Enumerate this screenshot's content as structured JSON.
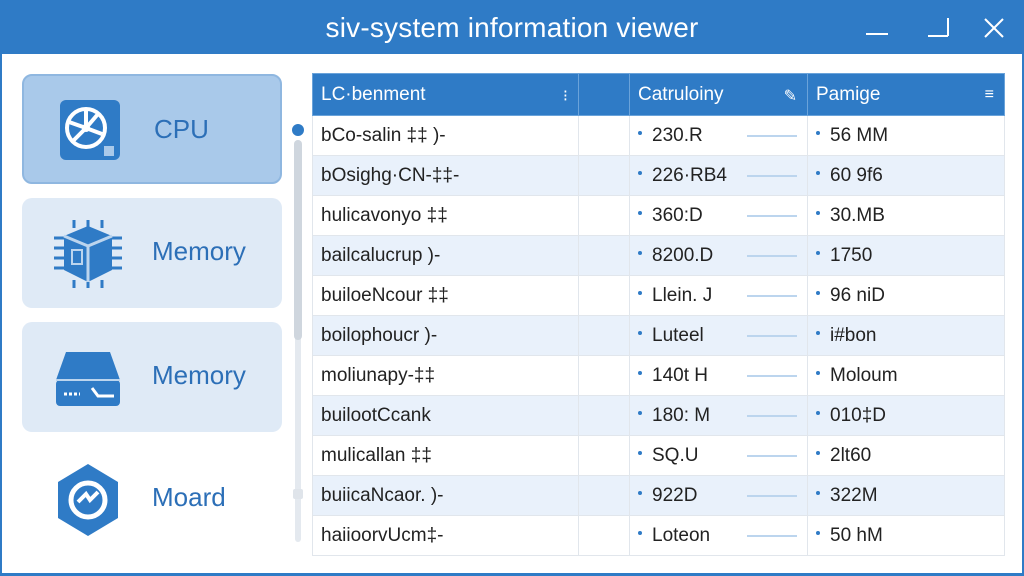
{
  "window": {
    "title": "siv-system information viewer"
  },
  "sidebar": {
    "items": [
      {
        "label": "CPU",
        "icon": "cpu-fan-icon",
        "active": true
      },
      {
        "label": "Memory",
        "icon": "chip-icon",
        "active": false
      },
      {
        "label": "Memory",
        "icon": "drive-icon",
        "active": false
      },
      {
        "label": "Moard",
        "icon": "motherboard-icon",
        "active": false
      }
    ]
  },
  "table": {
    "columns": [
      "LC·benment",
      "",
      "Catruloiny",
      "Pamige"
    ],
    "rows": [
      {
        "name": "bCo-salin ‡‡ )-",
        "capacity": "230.R",
        "range": "56 M‌M"
      },
      {
        "name": "bOsighg·CN-‡‡-",
        "capacity": "226·RB4",
        "range": "60 9f6"
      },
      {
        "name": "hulicavonyo ‡‡",
        "capacity": "360:D",
        "range": "30.MB"
      },
      {
        "name": "bailcalucrup )-",
        "capacity": "8200.D",
        "range": "1750"
      },
      {
        "name": "builoeNcour ‡‡",
        "capacity": "Llein. J",
        "range": "96 niD"
      },
      {
        "name": "boilophoucr )-",
        "capacity": "Luteel",
        "range": "i#bon"
      },
      {
        "name": "moliunapy-‡‡",
        "capacity": "140t H",
        "range": "Moloum"
      },
      {
        "name": "builootCcank",
        "capacity": "180: M",
        "range": "010‡D"
      },
      {
        "name": "mulicallan ‡‡",
        "capacity": "SQ.U",
        "range": "2lt60"
      },
      {
        "name": "buiicaNcaor. )-",
        "capacity": "922D",
        "range": "322M"
      },
      {
        "name": "haiioorvUcm‡-",
        "capacity": "Loteon",
        "range": "50 hM"
      }
    ]
  },
  "colors": {
    "accent": "#2f7bc6",
    "rowAlt": "#e9f1fb",
    "navBg": "#dfeaf6",
    "navActive": "#a9c9ea"
  }
}
